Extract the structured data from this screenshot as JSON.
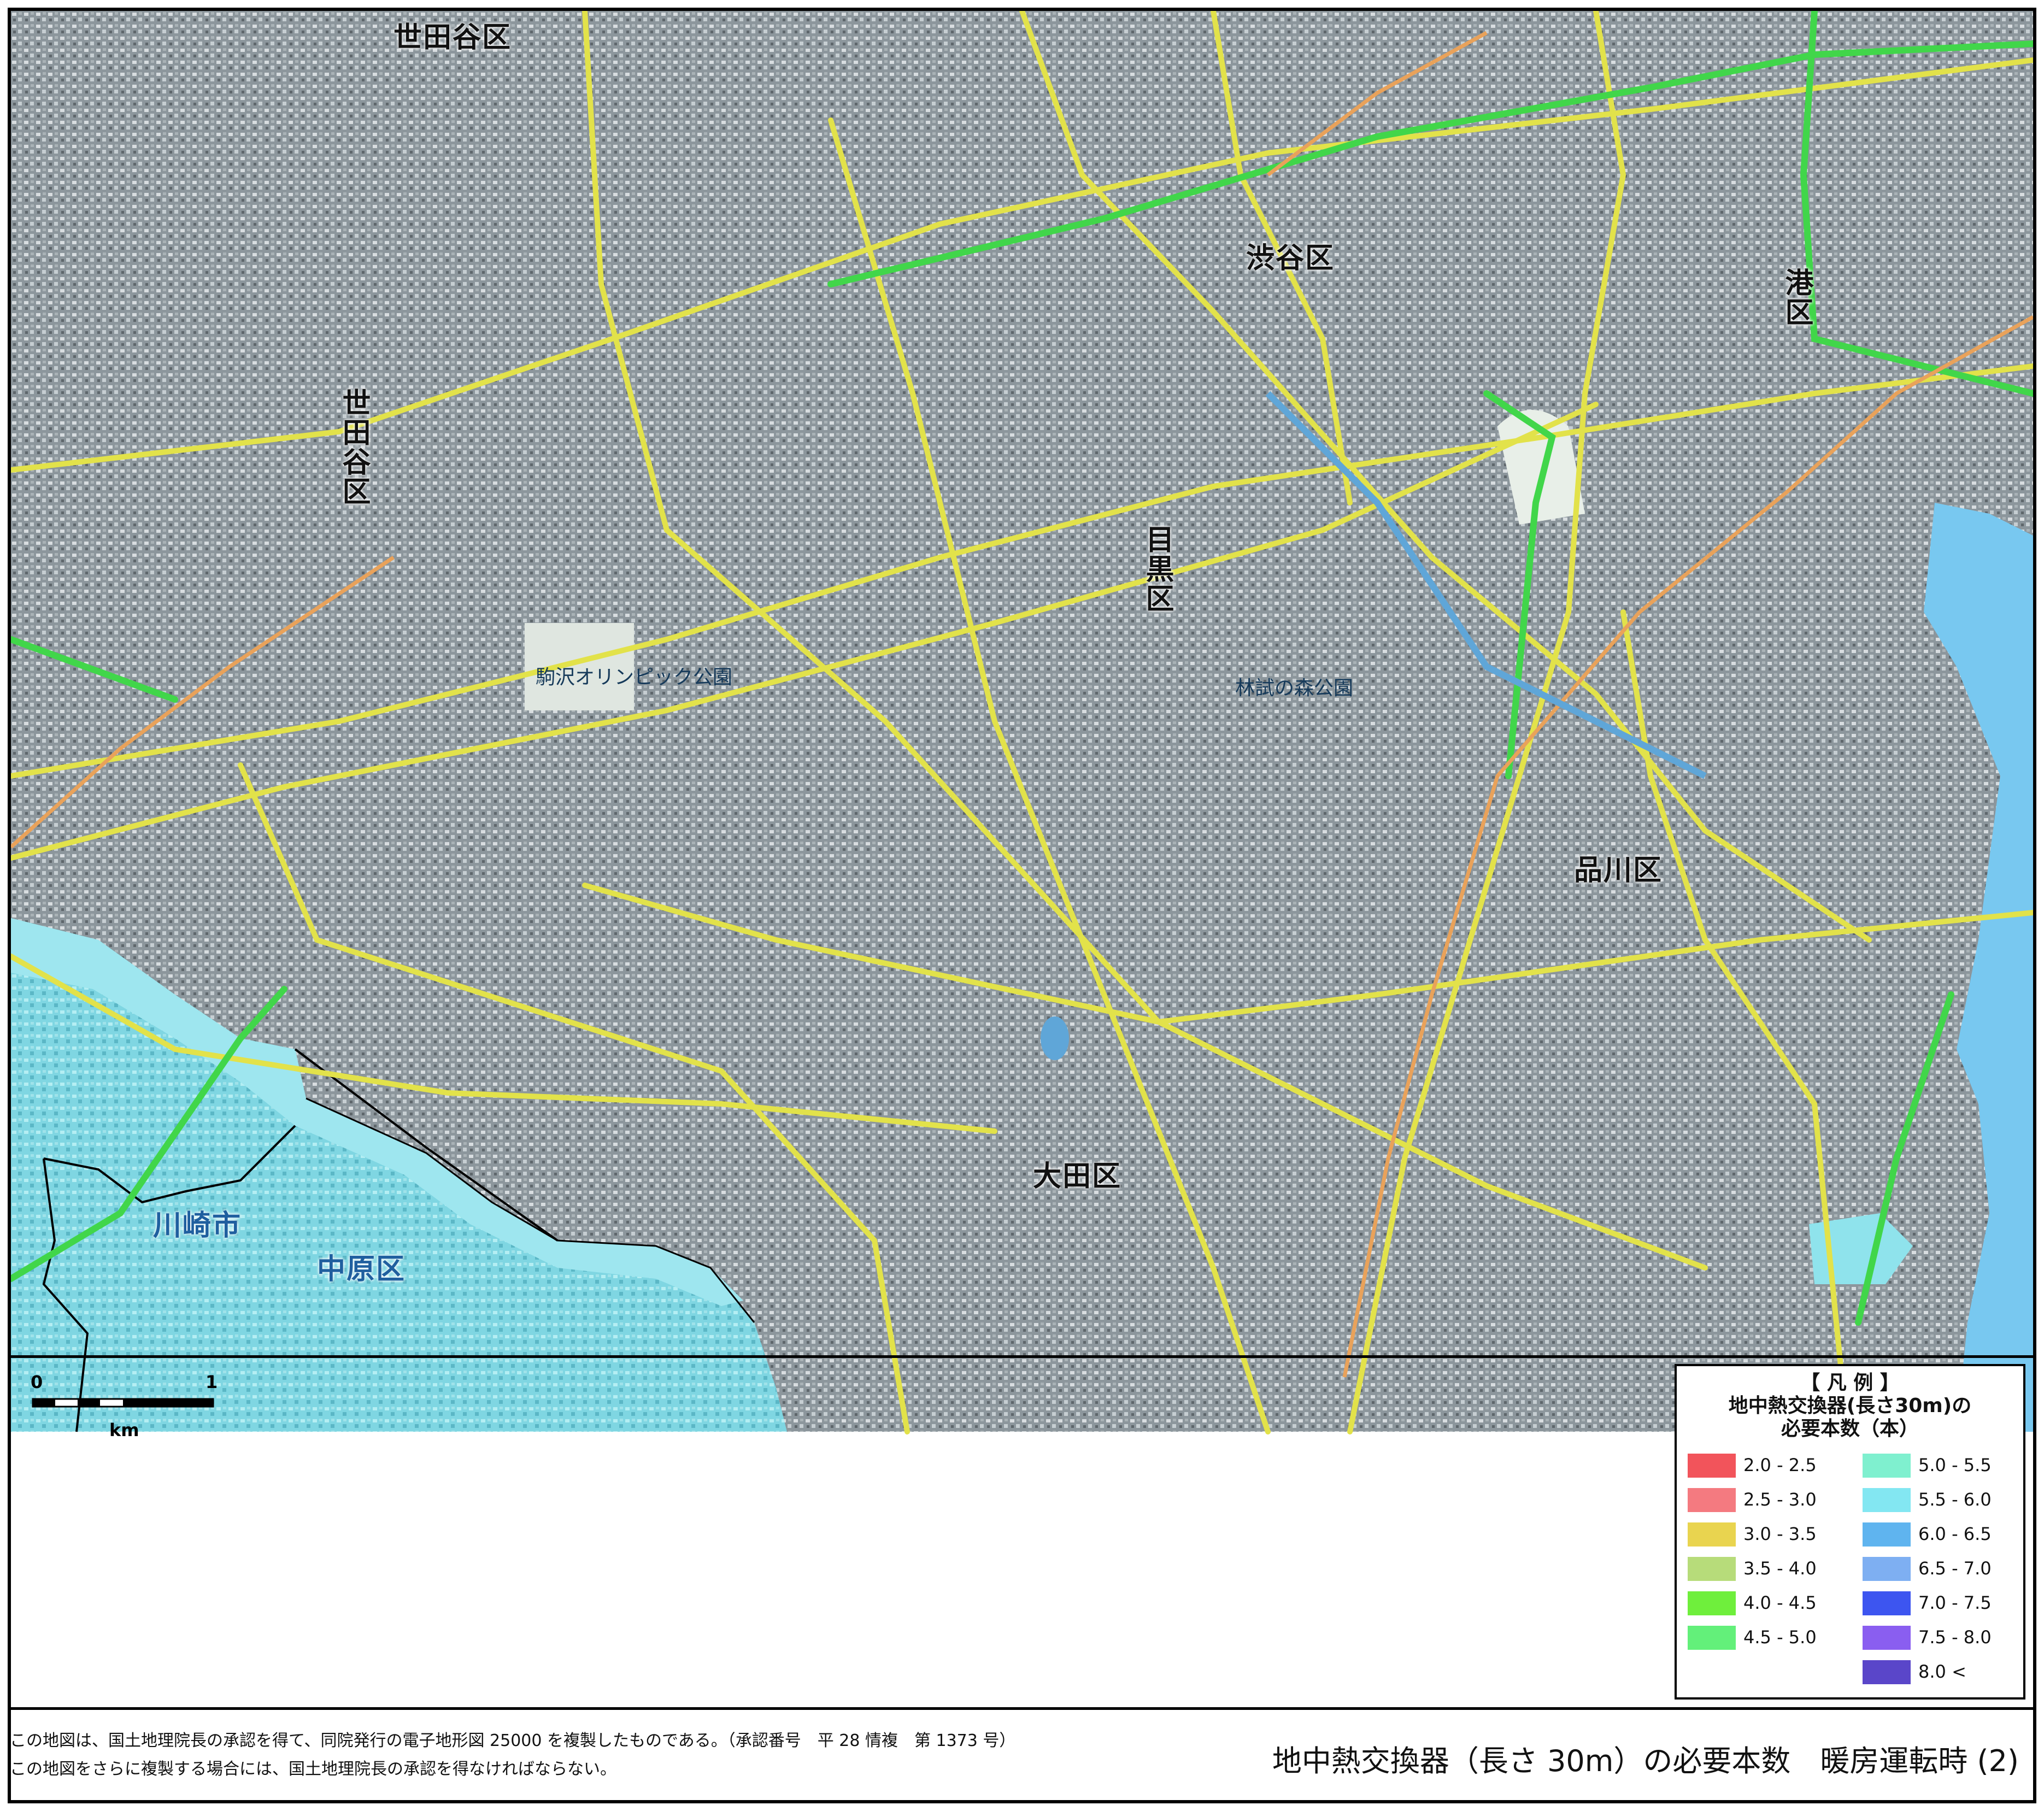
{
  "wards": {
    "setagaya_top": "世田谷区",
    "setagaya_mid": "世田谷区",
    "shibuya": "渋谷区",
    "minato": "港区",
    "meguro": "目黒区",
    "shinagawa": "品川区",
    "ota": "大田区",
    "kawasaki": "川崎市",
    "nakahara": "中原区"
  },
  "places": {
    "komazawa": "駒沢オリンピック公園",
    "rinshi": "林試の森公園"
  },
  "scale": {
    "zero": "0",
    "one": "1",
    "unit": "km"
  },
  "legend": {
    "title_line1": "【 凡 例 】",
    "title_line2": "地中熱交換器(長さ30m)の",
    "title_line3": "必要本数（本）",
    "items": [
      {
        "label": "2.0 - 2.5",
        "color": "#f2545b"
      },
      {
        "label": "2.5 - 3.0",
        "color": "#f47a80"
      },
      {
        "label": "3.0 - 3.5",
        "color": "#e9d44f"
      },
      {
        "label": "3.5 - 4.0",
        "color": "#b7dc7a"
      },
      {
        "label": "4.0 - 4.5",
        "color": "#6fef3c"
      },
      {
        "label": "4.5 - 5.0",
        "color": "#63f07a"
      },
      {
        "label": "5.0 - 5.5",
        "color": "#7ff0cf"
      },
      {
        "label": "5.5 - 6.0",
        "color": "#83e7f2"
      },
      {
        "label": "6.0 - 6.5",
        "color": "#5fb4ef"
      },
      {
        "label": "6.5 - 7.0",
        "color": "#7eaff2"
      },
      {
        "label": "7.0 - 7.5",
        "color": "#3d55f0"
      },
      {
        "label": "7.5 - 8.0",
        "color": "#8a5ef0"
      },
      {
        "label": "8.0 <",
        "color": "#5a46c9"
      }
    ]
  },
  "notes": {
    "line1": "この地図は、国土地理院長の承認を得て、同院発行の電子地形図 25000 を複製したものである。（承認番号　平 28 情複　第 1373 号）",
    "line2": "この地図をさらに複製する場合には、国土地理院長の承認を得なければならない。"
  },
  "caption": "地中熱交換器（長さ 30m）の必要本数　暖房運転時 (2)",
  "colors": {
    "map_base": "#8c969c",
    "road_yellow": "#e2e24a",
    "road_green": "#41d64a",
    "rail_orange": "#e9a25a",
    "water_blue": "#78c8f0",
    "cyan_zone": "#8fe3ec"
  }
}
